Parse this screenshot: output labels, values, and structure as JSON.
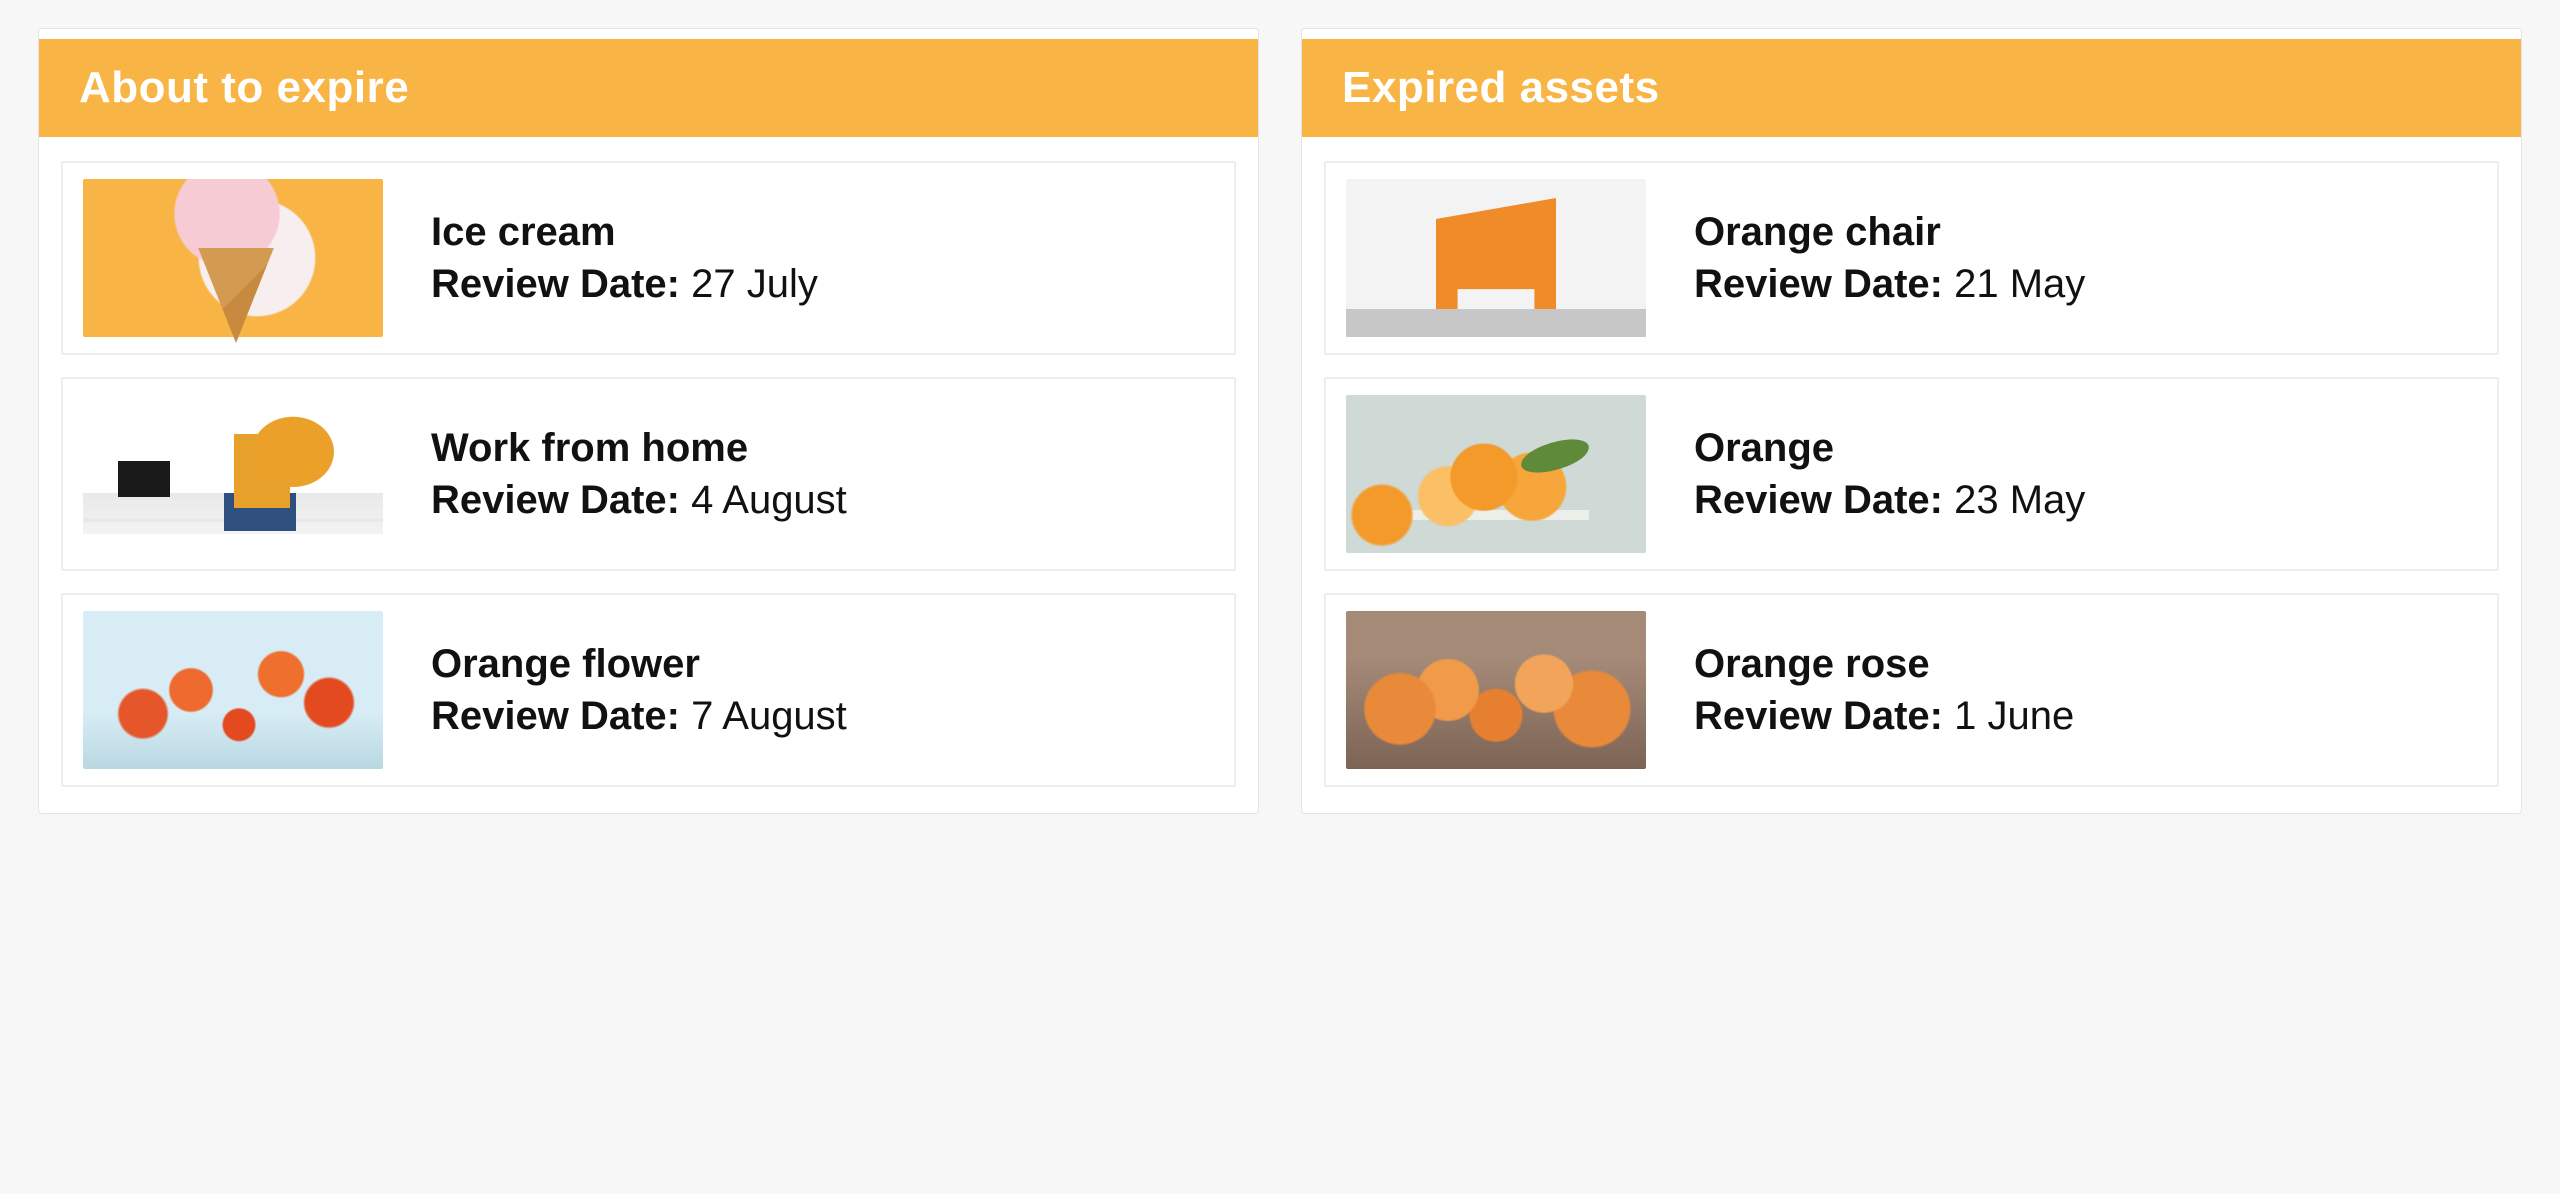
{
  "colors": {
    "header_bg": "#f8b444",
    "header_fg": "#ffffff"
  },
  "review_label": "Review Date:",
  "panels": [
    {
      "title": "About to expire",
      "items": [
        {
          "title": "Ice cream",
          "review_date": "27 July",
          "thumb": "thumb-ice-cream"
        },
        {
          "title": "Work from home",
          "review_date": "4 August",
          "thumb": "thumb-work-from-home"
        },
        {
          "title": "Orange flower",
          "review_date": "7 August",
          "thumb": "thumb-orange-flower"
        }
      ]
    },
    {
      "title": "Expired assets",
      "items": [
        {
          "title": "Orange chair",
          "review_date": "21 May",
          "thumb": "thumb-orange-chair"
        },
        {
          "title": "Orange",
          "review_date": "23 May",
          "thumb": "thumb-orange"
        },
        {
          "title": "Orange rose",
          "review_date": "1 June",
          "thumb": "thumb-orange-rose"
        }
      ]
    }
  ]
}
